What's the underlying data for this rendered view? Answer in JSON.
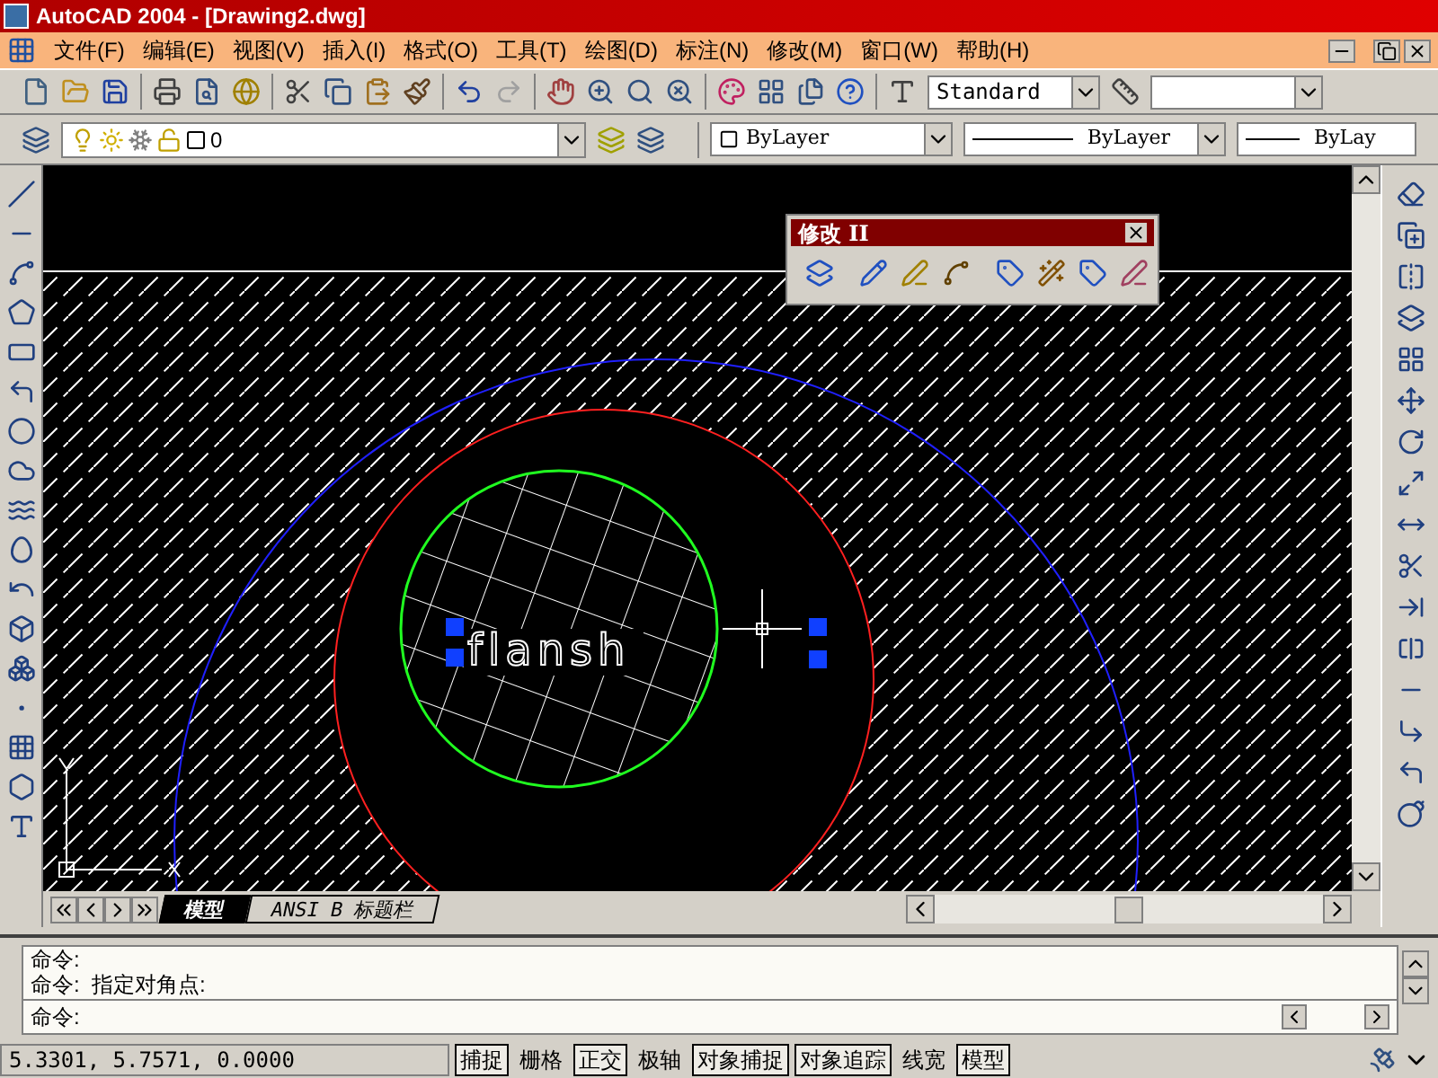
{
  "window": {
    "title": "AutoCAD 2004 - [Drawing2.dwg]"
  },
  "menu": [
    "文件(F)",
    "编辑(E)",
    "视图(V)",
    "插入(I)",
    "格式(O)",
    "工具(T)",
    "绘图(D)",
    "标注(N)",
    "修改(M)",
    "窗口(W)",
    "帮助(H)"
  ],
  "standard_toolbar": {
    "text_style": "Standard"
  },
  "properties_toolbar": {
    "layer": "0",
    "color_setting": "ByLayer",
    "linetype": "ByLayer",
    "lineweight": "ByLay"
  },
  "drawing": {
    "text": "flansh"
  },
  "floating_toolbar": {
    "title": "修改 II"
  },
  "layout_tabs": [
    {
      "label": "模型",
      "selected": true
    },
    {
      "label": "ANSI B 标题栏",
      "selected": false
    }
  ],
  "command_history": [
    "命令:",
    "命令:  指定对角点:"
  ],
  "command_prompt": "命令:",
  "status_bar": {
    "coordinates": "5.3301, 5.7571, 0.0000",
    "toggles": [
      {
        "label": "捕捉",
        "on": true
      },
      {
        "label": "栅格",
        "on": false
      },
      {
        "label": "正交",
        "on": true
      },
      {
        "label": "极轴",
        "on": false
      },
      {
        "label": "对象捕捉",
        "on": true
      },
      {
        "label": "对象追踪",
        "on": true
      },
      {
        "label": "线宽",
        "on": false
      },
      {
        "label": "模型",
        "on": true
      }
    ]
  }
}
